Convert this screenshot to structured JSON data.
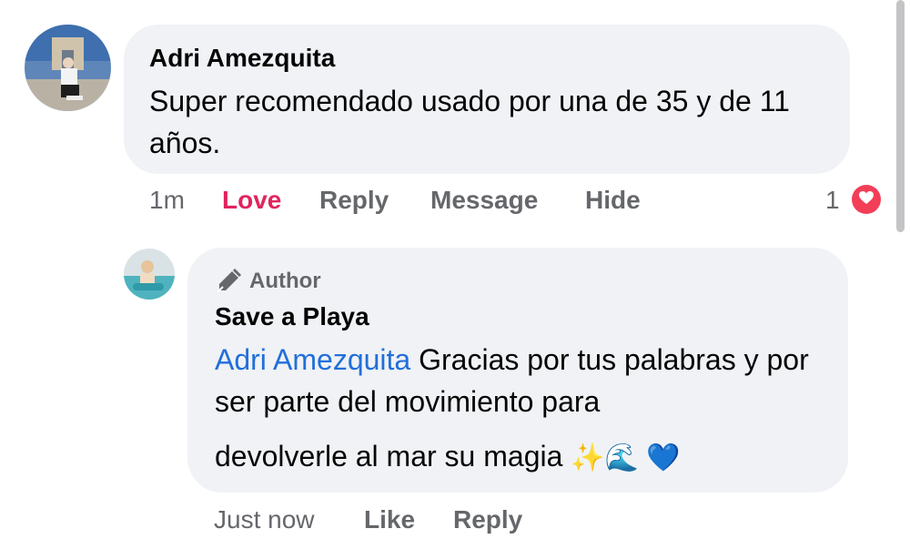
{
  "comment": {
    "author": "Adri Amezquita",
    "text": "Super recomendado usado por una de 35 y de 11 años.",
    "actions": {
      "time": "1m",
      "love": "Love",
      "reply": "Reply",
      "message": "Message",
      "hide": "Hide"
    },
    "reaction_count": "1",
    "reaction_icon": "heart-icon"
  },
  "reply": {
    "badge": "Author",
    "badge_icon": "pencil-icon",
    "author": "Save a Playa",
    "mention": "Adri Amezquita",
    "text_line1": " Gracias por tus palabras y por ser parte del movimiento para",
    "text_line2": "devolverle al mar su magia ",
    "emojis": "✨🌊 💙",
    "actions": {
      "time": "Just now",
      "like": "Like",
      "reply": "Reply"
    }
  },
  "colors": {
    "bubble": "#f0f2f5",
    "mention": "#216fdb",
    "love": "#e0245e",
    "muted": "#65676b"
  }
}
